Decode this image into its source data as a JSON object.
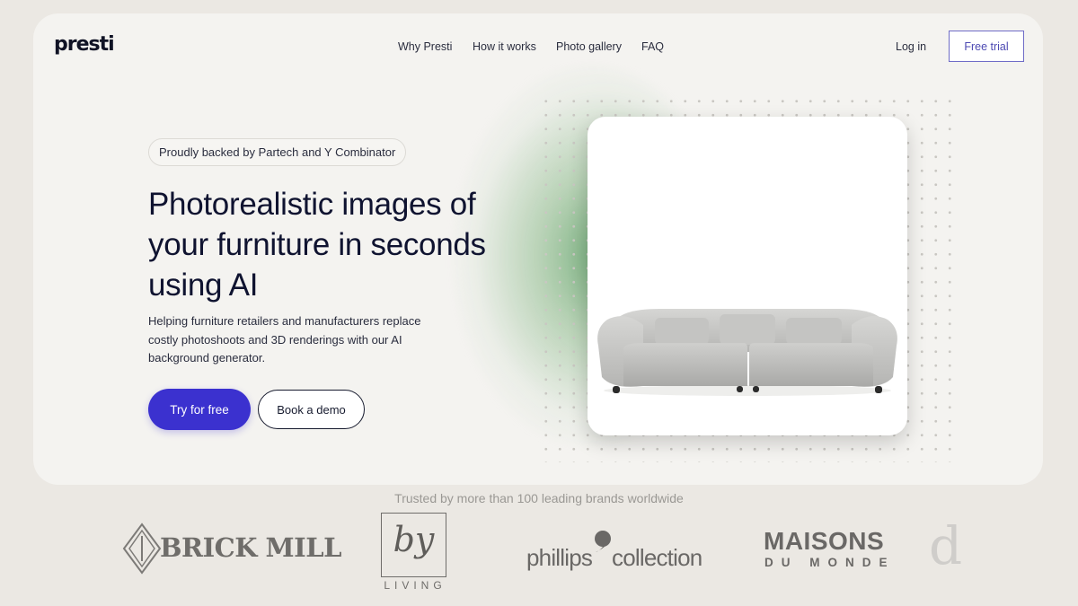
{
  "header": {
    "logo": "presti",
    "nav": [
      "Why Presti",
      "How it works",
      "Photo gallery",
      "FAQ"
    ],
    "login_label": "Log in",
    "trial_label": "Free trial"
  },
  "hero": {
    "badge": "Proudly backed by Partech and Y Combinator",
    "title_lines": [
      "Photorealistic images of",
      "your furniture in seconds",
      "using AI"
    ],
    "subtitle_lines": [
      "Helping furniture retailers and manufacturers replace",
      "costly photoshoots and 3D renderings with our AI",
      "background generator."
    ],
    "primary_cta": "Try for free",
    "secondary_cta": "Book a demo"
  },
  "trusted": {
    "caption": "Trusted by more than 100 leading brands worldwide",
    "brands": [
      "BRICK MILL",
      "by",
      "LIVING",
      "phillips",
      "collection",
      "MAISONS",
      "DU MONDE",
      "d"
    ]
  },
  "colors": {
    "primary": "#3b31cf",
    "accent_outline": "#6f6cc7",
    "glow": "#4a9654",
    "text": "#0f1330"
  }
}
